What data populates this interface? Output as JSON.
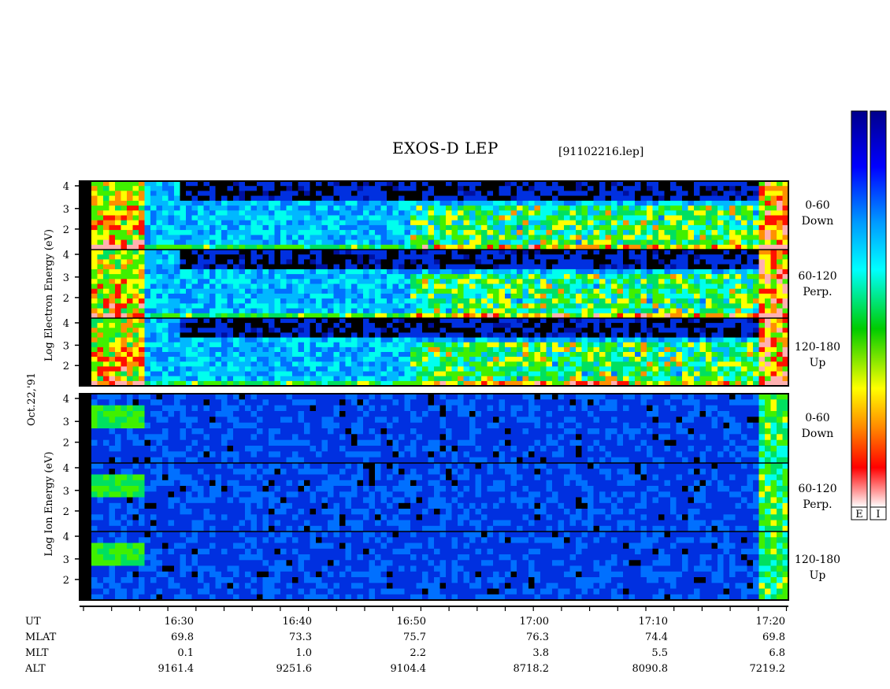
{
  "title": "EXOS-D LEP",
  "file": "[91102216.lep]",
  "date_label": "Oct.22,'91",
  "electron": {
    "ylabel_parts": [
      "Log",
      "Electron",
      "Energy",
      "(eV)"
    ],
    "panels": [
      {
        "angle": "0-60",
        "dir": "Down"
      },
      {
        "angle": "60-120",
        "dir": "Perp."
      },
      {
        "angle": "120-180",
        "dir": "Up"
      }
    ]
  },
  "ion": {
    "ylabel_parts": [
      "Log",
      "Ion",
      "Energy",
      "(eV)"
    ],
    "panels": [
      {
        "angle": "0-60",
        "dir": "Down"
      },
      {
        "angle": "60-120",
        "dir": "Perp."
      },
      {
        "angle": "120-180",
        "dir": "Up"
      }
    ]
  },
  "ytick_labels": [
    "2",
    "3",
    "4"
  ],
  "footer": {
    "row_labels": [
      "UT",
      "MLAT",
      "MLT",
      "ALT"
    ],
    "columns": [
      {
        "ut": "16:30",
        "mlat": "69.8",
        "mlt": "0.1",
        "alt": "9161.4"
      },
      {
        "ut": "16:40",
        "mlat": "73.3",
        "mlt": "1.0",
        "alt": "9251.6"
      },
      {
        "ut": "16:50",
        "mlat": "75.7",
        "mlt": "2.2",
        "alt": "9104.4"
      },
      {
        "ut": "17:00",
        "mlat": "76.3",
        "mlt": "3.8",
        "alt": "8718.2"
      },
      {
        "ut": "17:10",
        "mlat": "74.4",
        "mlt": "5.5",
        "alt": "8090.8"
      },
      {
        "ut": "17:20",
        "mlat": "69.8",
        "mlt": "6.8",
        "alt": "7219.2"
      }
    ]
  },
  "colorbars": [
    {
      "label": "E"
    },
    {
      "label": "I"
    }
  ],
  "colors": {
    "scale": [
      "#ffffff",
      "#ff0000",
      "#ff8800",
      "#ffff00",
      "#00cc00",
      "#00ffff",
      "#0088ff",
      "#0000ff",
      "#00008b"
    ],
    "background_panel": "#1530c8"
  },
  "chart_data": {
    "type": "heatmap",
    "title": "EXOS-D LEP",
    "subtitle": "[91102216.lep]",
    "x_axis": "UT",
    "x_ticks": [
      "16:30",
      "16:40",
      "16:50",
      "17:00",
      "17:10",
      "17:20"
    ],
    "y_ticks": [
      2,
      3,
      4
    ],
    "panels": [
      {
        "species": "Electron",
        "pitch_angle": "0-60",
        "label": "Down"
      },
      {
        "species": "Electron",
        "pitch_angle": "60-120",
        "label": "Perp."
      },
      {
        "species": "Electron",
        "pitch_angle": "120-180",
        "label": "Up"
      },
      {
        "species": "Ion",
        "pitch_angle": "0-60",
        "label": "Down"
      },
      {
        "species": "Ion",
        "pitch_angle": "60-120",
        "label": "Perp."
      },
      {
        "species": "Ion",
        "pitch_angle": "120-180",
        "label": "Up"
      }
    ]
  }
}
